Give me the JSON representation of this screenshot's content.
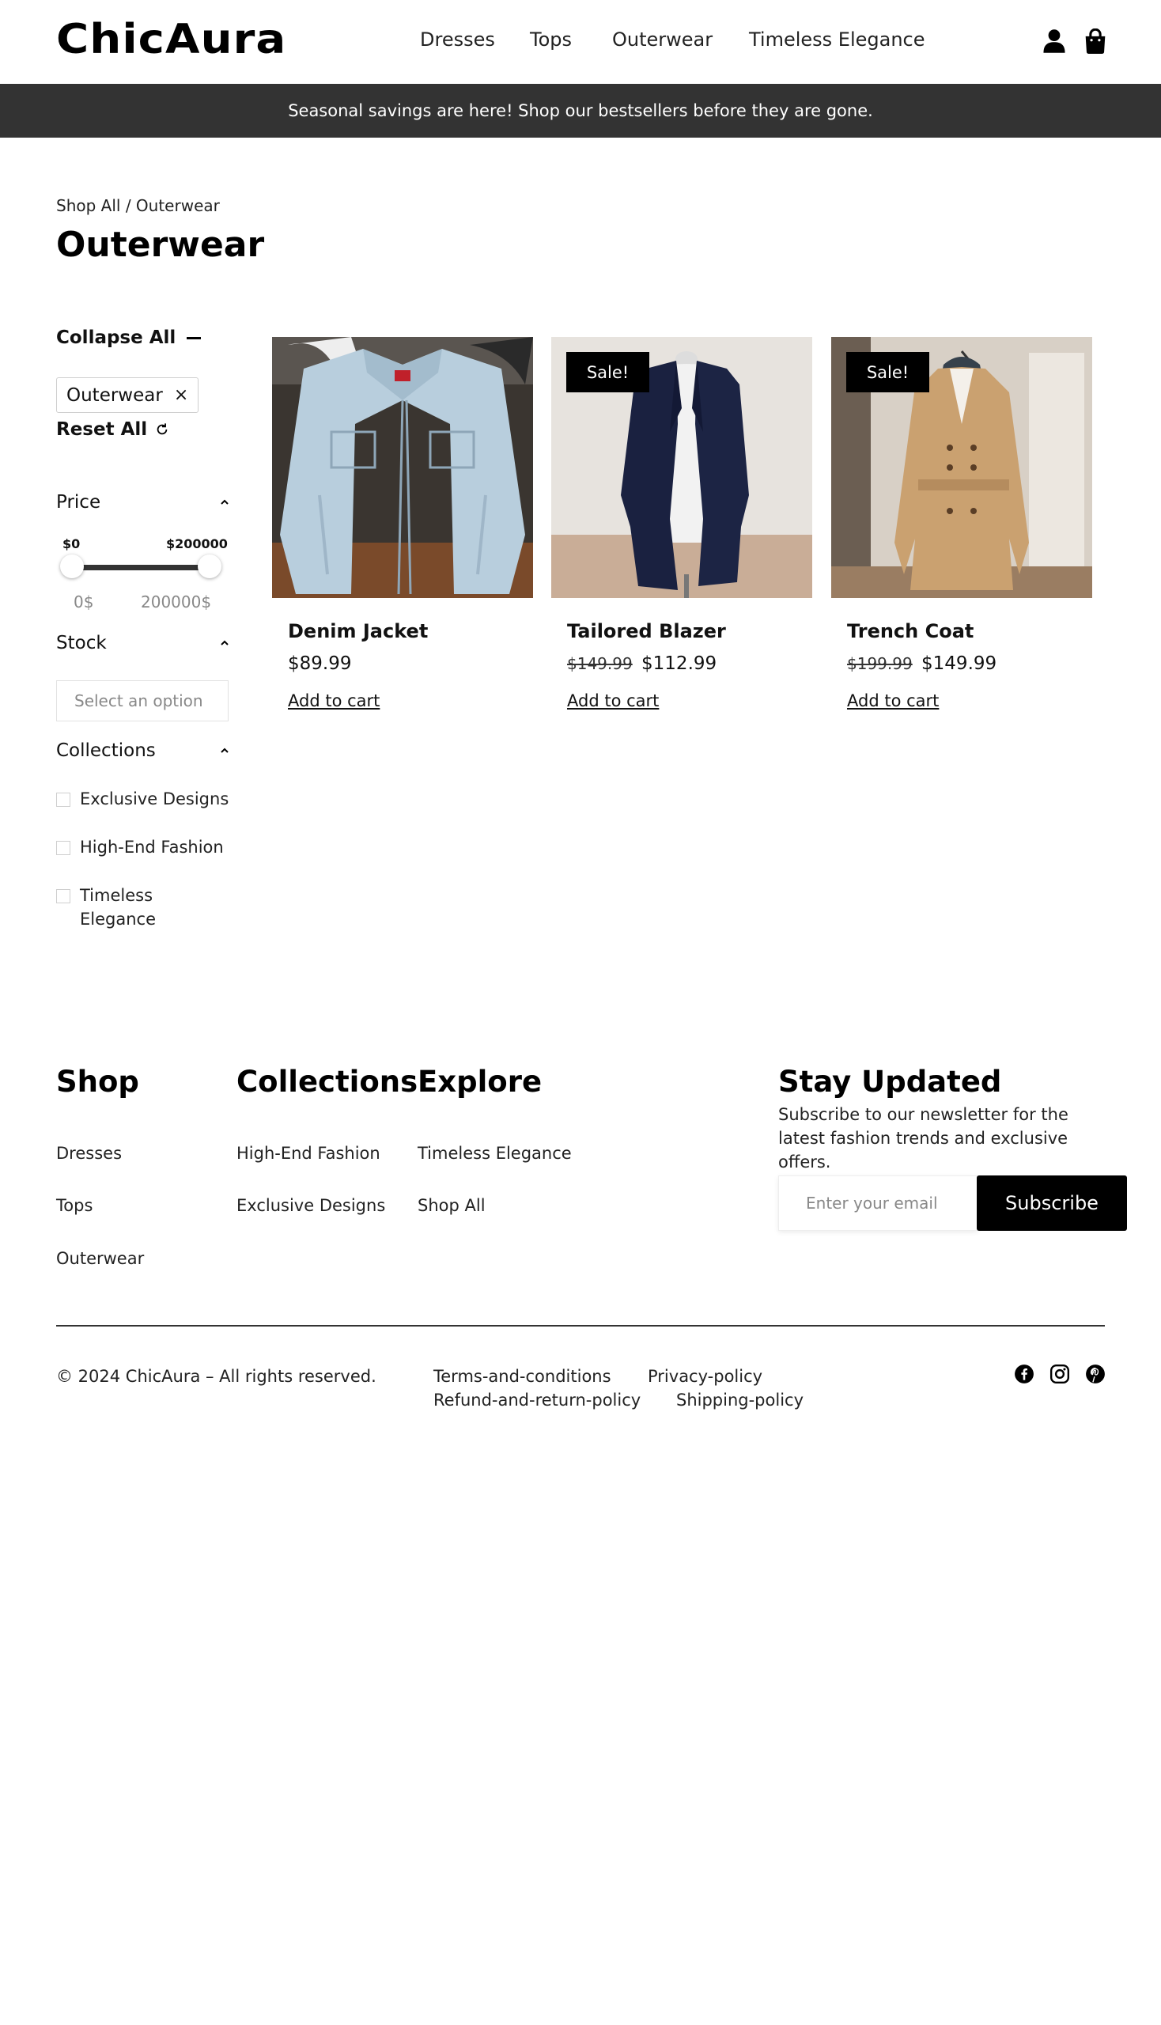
{
  "header": {
    "logo": "ChicAura",
    "nav": [
      "Dresses",
      "Tops",
      "Outerwear",
      "Timeless Elegance"
    ],
    "icons": [
      "user-icon",
      "shopping-bag-icon"
    ]
  },
  "announcement": "Seasonal savings are here! Shop our bestsellers before they are gone.",
  "breadcrumb": {
    "root": "Shop All",
    "separator": " / ",
    "current": "Outerwear"
  },
  "page_title": "Outerwear",
  "filters": {
    "collapse_all": "Collapse All",
    "active_chip": "Outerwear",
    "chip_remove": "×",
    "reset_all": "Reset All",
    "price": {
      "label": "Price",
      "min_label": "$0",
      "max_label": "$200000",
      "range_min": "0$",
      "range_max": "200000$"
    },
    "stock": {
      "label": "Stock",
      "placeholder": "Select an option"
    },
    "collections": {
      "label": "Collections",
      "options": [
        "Exclusive Designs",
        "High-End Fashion",
        "Timeless Elegance"
      ]
    }
  },
  "products": [
    {
      "name": "Denim Jacket",
      "old_price": "",
      "price": "$89.99",
      "sale_badge": "",
      "cart": "Add to cart"
    },
    {
      "name": "Tailored Blazer",
      "old_price": "$149.99",
      "price": "$112.99",
      "sale_badge": "Sale!",
      "cart": "Add to cart"
    },
    {
      "name": "Trench Coat",
      "old_price": "$199.99",
      "price": "$149.99",
      "sale_badge": "Sale!",
      "cart": "Add to cart"
    }
  ],
  "footer": {
    "shop": {
      "title": "Shop",
      "links": [
        "Dresses",
        "Tops",
        "Outerwear"
      ]
    },
    "collections": {
      "title": "Collections",
      "links": [
        "High-End Fashion",
        "Exclusive Designs"
      ]
    },
    "explore": {
      "title": "Explore",
      "links": [
        "Timeless Elegance",
        "Shop All"
      ]
    },
    "newsletter": {
      "title": "Stay Updated",
      "text": "Subscribe to our newsletter for the latest fashion trends and exclusive offers.",
      "placeholder": "Enter your email",
      "button": "Subscribe"
    },
    "copyright": "© 2024 ChicAura – All rights reserved.",
    "legal": [
      "Terms-and-conditions",
      "Privacy-policy",
      "Refund-and-return-policy",
      "Shipping-policy"
    ],
    "social": [
      "facebook-icon",
      "instagram-icon",
      "pinterest-icon"
    ]
  }
}
